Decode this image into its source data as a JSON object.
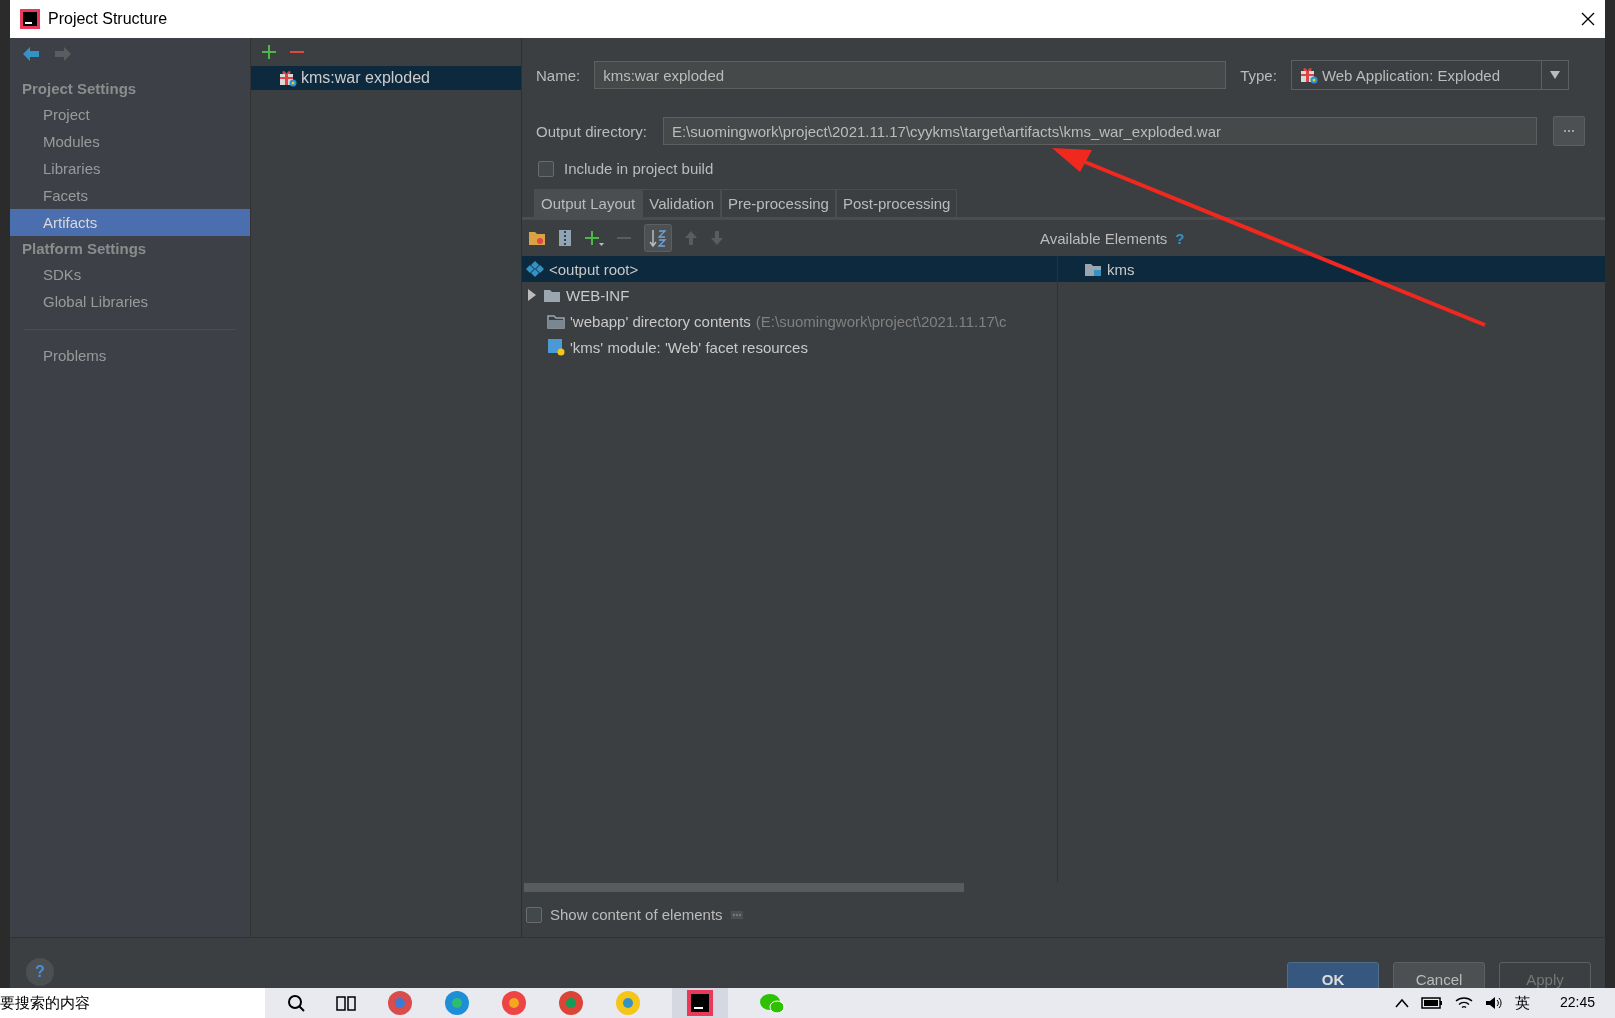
{
  "window": {
    "title": "Project Structure"
  },
  "sidebar": {
    "sections": [
      {
        "heading": "Project Settings",
        "items": [
          {
            "label": "Project",
            "selected": false
          },
          {
            "label": "Modules",
            "selected": false
          },
          {
            "label": "Libraries",
            "selected": false
          },
          {
            "label": "Facets",
            "selected": false
          },
          {
            "label": "Artifacts",
            "selected": true
          }
        ]
      },
      {
        "heading": "Platform Settings",
        "items": [
          {
            "label": "SDKs",
            "selected": false
          },
          {
            "label": "Global Libraries",
            "selected": false
          }
        ]
      }
    ],
    "bottom_items": [
      {
        "label": "Problems",
        "selected": false
      }
    ]
  },
  "artifacts": {
    "items": [
      {
        "label": "kms:war exploded",
        "selected": true
      }
    ]
  },
  "name_field": {
    "label": "Name:",
    "value": "kms:war exploded"
  },
  "type_field": {
    "label": "Type:",
    "value": "Web Application: Exploded"
  },
  "output_directory": {
    "label": "Output directory:",
    "value": "E:\\suomingwork\\project\\2021.11.17\\cyykms\\target\\artifacts\\kms_war_exploded.war"
  },
  "include_in_build": {
    "label": "Include in project build",
    "checked": false
  },
  "tabs": [
    {
      "label": "Output Layout",
      "selected": true
    },
    {
      "label": "Validation",
      "selected": false
    },
    {
      "label": "Pre-processing",
      "selected": false
    },
    {
      "label": "Post-processing",
      "selected": false
    }
  ],
  "layout_tree": {
    "items": [
      {
        "label": "<output root>",
        "kind": "root",
        "selected": true
      },
      {
        "label": "WEB-INF",
        "kind": "folder",
        "expanded": false,
        "selected": false
      },
      {
        "label": "'webapp' directory contents",
        "detail": "(E:\\suomingwork\\project\\2021.11.17\\c",
        "kind": "directory",
        "selected": false
      },
      {
        "label": "'kms' module: 'Web' facet resources",
        "kind": "facet",
        "selected": false
      }
    ]
  },
  "available_elements": {
    "title": "Available Elements",
    "help": "?",
    "items": [
      {
        "label": "kms",
        "selected": true
      }
    ]
  },
  "show_content": {
    "label": "Show content of elements",
    "checked": false
  },
  "help_button": "?",
  "buttons": [
    {
      "label": "OK",
      "kind": "primary"
    },
    {
      "label": "Cancel",
      "kind": "normal"
    },
    {
      "label": "Apply",
      "kind": "disabled"
    }
  ],
  "taskbar": {
    "search_text": "要搜索的内容",
    "ime": "英",
    "clock": "22:45"
  }
}
